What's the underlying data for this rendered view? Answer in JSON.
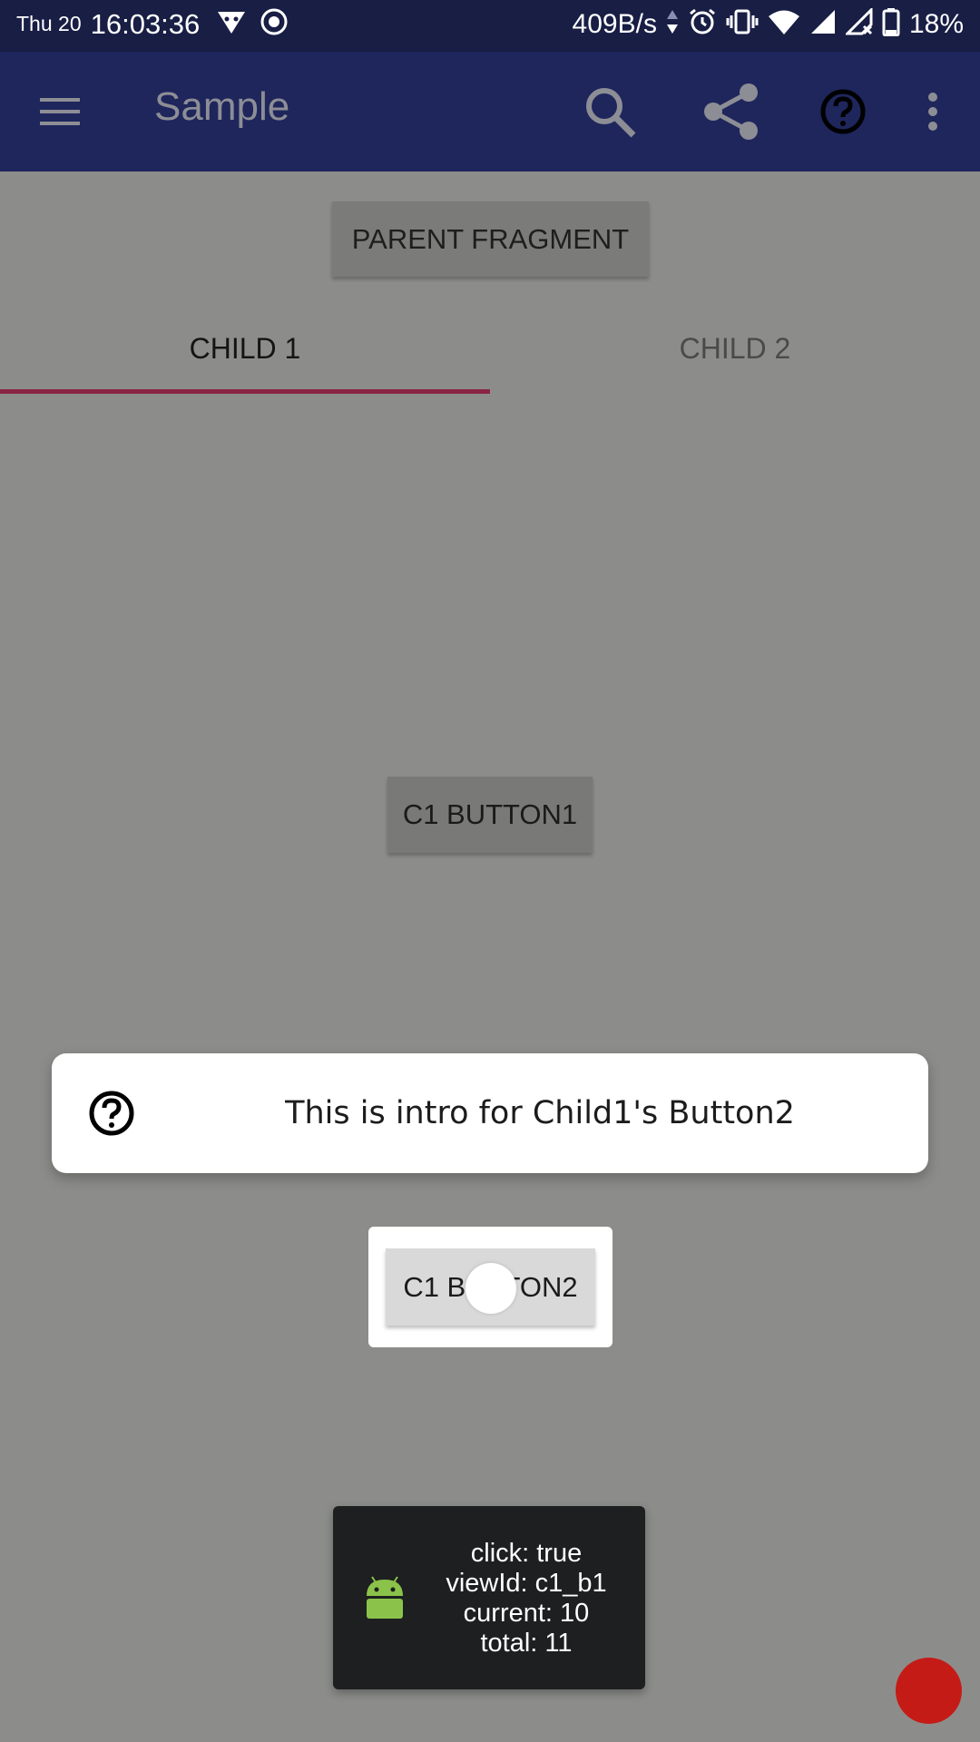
{
  "status_bar": {
    "day": "Thu 20",
    "time": "16:03:36",
    "net_speed": "409B/s",
    "battery": "18%"
  },
  "app_bar": {
    "title": "Sample",
    "icons": [
      "menu-icon",
      "search-icon",
      "share-icon",
      "help-icon",
      "more-vert-icon"
    ]
  },
  "parent_fragment_button": "PARENT FRAGMENT",
  "tabs": [
    {
      "label": "CHILD 1",
      "selected": true
    },
    {
      "label": "CHILD 2",
      "selected": false
    }
  ],
  "child1_button1": "C1 BUTTON1",
  "intro": {
    "text": "This is intro for Child1's Button2",
    "icon": "help-icon"
  },
  "child1_button2": "C1 BUTTON2",
  "toast": {
    "icon": "android-icon",
    "lines": [
      "click: true",
      "viewId: c1_b1",
      "current: 10",
      "total: 11"
    ]
  },
  "colors": {
    "status_bar": "#181e44",
    "app_bar": "#1e265c",
    "tab_indicator": "#8a2447",
    "scrim_background": "#8c8d8a",
    "record_dot": "#c51b17"
  }
}
